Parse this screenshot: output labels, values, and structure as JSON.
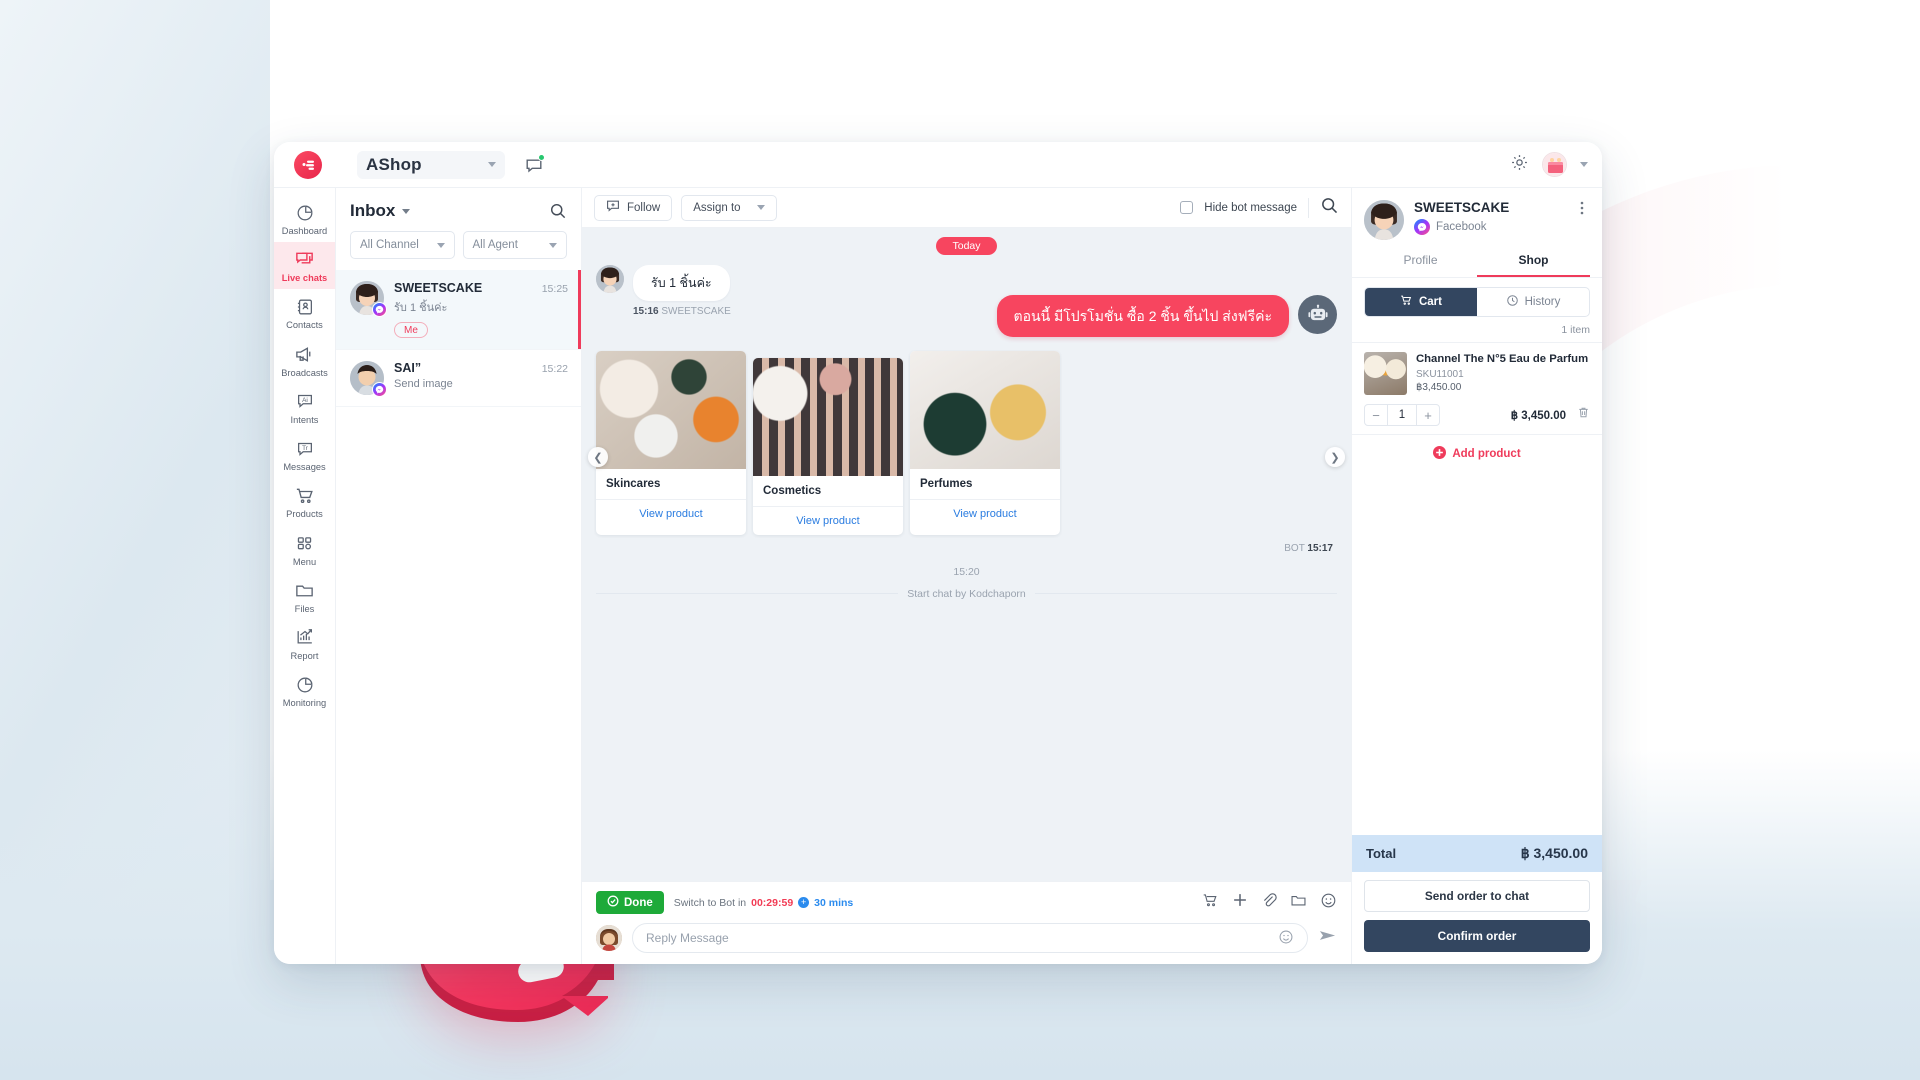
{
  "topbar": {
    "workspace": "AShop",
    "logo_icon": "amity-chat-logo",
    "dropdown_icon": "chevron-down-icon",
    "chat_icon": "chat-bubble-icon",
    "settings_icon": "gear-icon",
    "avatar_icon": "user-avatar",
    "account_caret_icon": "chevron-down-icon"
  },
  "sidebar": {
    "items": [
      {
        "label": "Dashboard",
        "icon": "pie-chart-icon",
        "active": false
      },
      {
        "label": "Live chats",
        "icon": "chat-bubbles-icon",
        "active": true
      },
      {
        "label": "Contacts",
        "icon": "contact-book-icon",
        "active": false
      },
      {
        "label": "Broadcasts",
        "icon": "megaphone-icon",
        "active": false
      },
      {
        "label": "Intents",
        "icon": "ai-bubble-icon",
        "active": false
      },
      {
        "label": "Messages",
        "icon": "text-bubble-icon",
        "active": false
      },
      {
        "label": "Products",
        "icon": "shopping-cart-icon",
        "active": false
      },
      {
        "label": "Menu",
        "icon": "grid-icon",
        "active": false
      },
      {
        "label": "Files",
        "icon": "folder-icon",
        "active": false
      },
      {
        "label": "Report",
        "icon": "bar-chart-icon",
        "active": false
      },
      {
        "label": "Monitoring",
        "icon": "gauge-icon",
        "active": false
      }
    ]
  },
  "inbox": {
    "title": "Inbox",
    "title_caret_icon": "chevron-down-icon",
    "search_icon": "search-icon",
    "filters": [
      {
        "value": "All Channel",
        "icon": "chevron-down-icon"
      },
      {
        "value": "All Agent",
        "icon": "chevron-down-icon"
      }
    ],
    "conversations": [
      {
        "name": "SWEETSCAKE",
        "preview": "รับ 1 ชิ้นค่ะ",
        "time": "15:25",
        "tag": "Me",
        "channel_icon": "messenger-icon",
        "selected": true
      },
      {
        "name": "SAI”",
        "preview": "Send image",
        "time": "15:22",
        "tag": "",
        "channel_icon": "messenger-icon",
        "selected": false
      }
    ]
  },
  "chat": {
    "toolbar": {
      "follow_label": "Follow",
      "follow_icon": "add-to-chat-icon",
      "assign_label": "Assign to",
      "assign_caret_icon": "chevron-down-icon",
      "hide_bot_label": "Hide bot message",
      "hide_bot_checked": false,
      "search_icon": "search-icon"
    },
    "day_divider": "Today",
    "incoming": {
      "text": "รับ 1 ชิ้นค่ะ",
      "time": "15:16",
      "sender": "SWEETSCAKE"
    },
    "outgoing": {
      "text": "ตอนนี้ มีโปรโมชั่น ซื้อ 2 ชิ้น ขึ้นไป ส่งฟรีค่ะ",
      "avatar_icon": "robot-icon"
    },
    "carousel": {
      "prev_icon": "chevron-left-icon",
      "next_icon": "chevron-right-icon",
      "cards": [
        {
          "title": "Skincares",
          "cta": "View product"
        },
        {
          "title": "Cosmetics",
          "cta": "View product"
        },
        {
          "title": "Perfumes",
          "cta": "View product"
        }
      ],
      "sender_label": "BOT",
      "time": "15:17"
    },
    "system": {
      "time": "15:20",
      "text": "Start chat by Kodchaporn"
    },
    "composer": {
      "done_label": "Done",
      "done_icon": "check-circle-icon",
      "switch_prefix": "Switch to Bot in",
      "timer": "00:29:59",
      "extend_icon": "plus-circle-icon",
      "extend_label": "30 mins",
      "icons": [
        "cart-icon",
        "plus-icon",
        "paperclip-icon",
        "folder-icon",
        "smiley-icon"
      ],
      "placeholder": "Reply Message",
      "input_value": "",
      "emoji_icon": "smiley-icon",
      "send_icon": "send-icon",
      "avatar_icon": "agent-avatar"
    }
  },
  "right_panel": {
    "contact_name": "SWEETSCAKE",
    "channel": "Facebook",
    "channel_icon": "messenger-icon",
    "kebab_icon": "more-vertical-icon",
    "tabs": [
      {
        "label": "Profile",
        "active": false
      },
      {
        "label": "Shop",
        "active": true
      }
    ],
    "segments": [
      {
        "label": "Cart",
        "icon": "shopping-cart-icon",
        "active": true
      },
      {
        "label": "History",
        "icon": "clock-icon",
        "active": false
      }
    ],
    "item_count": "1 item",
    "cart_items": [
      {
        "name": "Channel The N°5 Eau de Parfum",
        "sku": "SKU11001",
        "unit_price": "฿3,450.00",
        "qty": "1",
        "line_total": "฿ 3,450.00",
        "minus_icon": "minus-icon",
        "plus_icon": "plus-icon",
        "delete_icon": "trash-icon"
      }
    ],
    "add_product_label": "Add product",
    "add_product_icon": "plus-circle-icon",
    "total_label": "Total",
    "total_value": "฿ 3,450.00",
    "send_order_label": "Send order to chat",
    "confirm_order_label": "Confirm order"
  },
  "colors": {
    "brand_red": "#ef3b5b",
    "bubble_red": "#f7455f",
    "navy": "#334660",
    "link_blue": "#2a7ce0",
    "done_green": "#1eaa39",
    "total_bg": "#cfe3f7"
  }
}
